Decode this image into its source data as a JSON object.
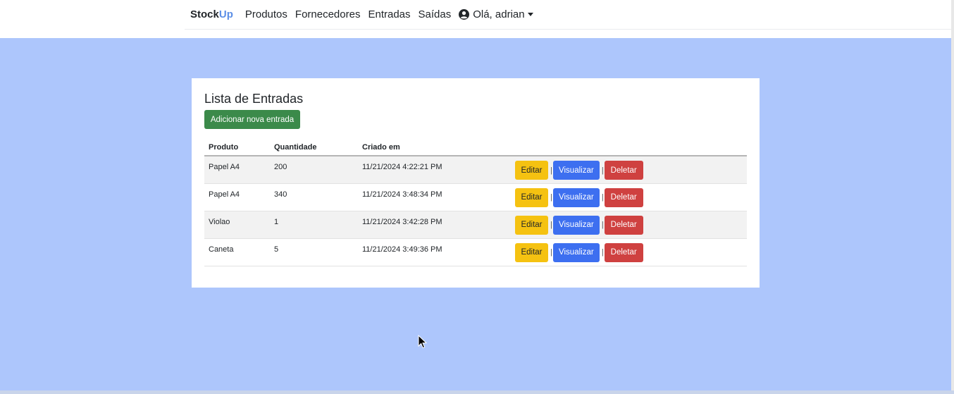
{
  "navbar": {
    "brand_main": "Stock",
    "brand_accent": "Up",
    "links": [
      "Produtos",
      "Fornecedores",
      "Entradas",
      "Saídas"
    ],
    "user_label": "Olá, adrian"
  },
  "page": {
    "title": "Lista de Entradas",
    "add_button": "Adicionar nova entrada"
  },
  "table": {
    "headers": [
      "Produto",
      "Quantidade",
      "Criado em"
    ],
    "rows": [
      {
        "produto": "Papel A4",
        "quantidade": "200",
        "criado_em": "11/21/2024 4:22:21 PM"
      },
      {
        "produto": "Papel A4",
        "quantidade": "340",
        "criado_em": "11/21/2024 3:48:34 PM"
      },
      {
        "produto": "Violao",
        "quantidade": "1",
        "criado_em": "11/21/2024 3:42:28 PM"
      },
      {
        "produto": "Caneta",
        "quantidade": "5",
        "criado_em": "11/21/2024 3:49:36 PM"
      }
    ]
  },
  "actions": {
    "edit": "Editar",
    "view": "Visualizar",
    "delete": "Deletar",
    "separator": "|"
  },
  "colors": {
    "background": "#adc6fc",
    "brand_accent": "#5b8ee6",
    "add_button": "#3b8a4a",
    "edit_button": "#f5c211",
    "view_button": "#3d6ff0",
    "delete_button": "#cf4140"
  }
}
